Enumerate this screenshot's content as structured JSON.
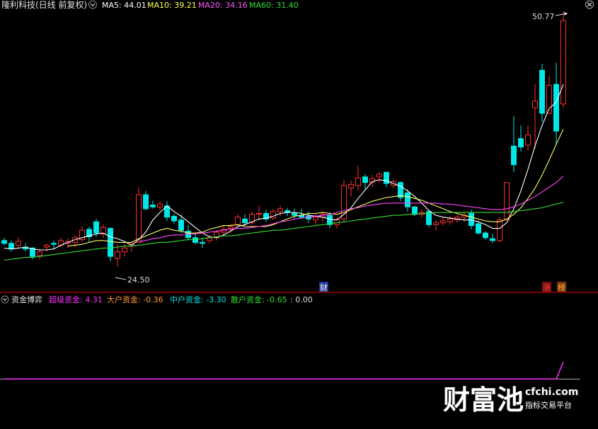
{
  "colors": {
    "background": "#000000",
    "grid": "#8b0000",
    "up": "#ff3030",
    "down": "#00e8e8",
    "ma5": "#ffffff",
    "ma10": "#ffff66",
    "ma20": "#ff44ff",
    "ma60": "#33dd33",
    "super": "#ff33ff",
    "big": "#ff9933",
    "mid": "#00e5e5",
    "retail": "#33dd33",
    "zero": "#dddddd",
    "header": "#e0e0e0"
  },
  "header": {
    "title": "隆利科技(日线 前复权)",
    "indicators": [
      {
        "label": "MA5: 44.01",
        "color": "#ffffff"
      },
      {
        "label": "MA10: 39.21",
        "color": "#ffff55"
      },
      {
        "label": "MA20: 34.16",
        "color": "#ff55ff"
      },
      {
        "label": "MA60: 31.40",
        "color": "#33dd33"
      }
    ]
  },
  "subchart_header": {
    "title": "资金博弈",
    "items": [
      {
        "label": "超级资金: 4.31",
        "color": "#ff33ff"
      },
      {
        "label": "大户资金: -0.36",
        "color": "#ff9933"
      },
      {
        "label": "中户资金: -3.30",
        "color": "#00e5e5"
      },
      {
        "label": "散户资金: -0.65",
        "color": "#33dd33"
      },
      {
        "label": ": 0.00",
        "color": "#dddddd"
      }
    ]
  },
  "annotations": {
    "high": "50.77",
    "low": "24.50",
    "marker_cai": "财",
    "marker_zhang": "涨",
    "marker_bang": "榜"
  },
  "watermark": {
    "brand": "财富池",
    "site": "cfchi.com",
    "slogan": "指标交易平台"
  },
  "chart_data": [
    {
      "type": "candlestick",
      "title": "隆利科技(日线 前复权)",
      "ylim": [
        23.5,
        51.8
      ],
      "candles": [
        [
          27.3,
          27.6,
          26.8,
          27.0
        ],
        [
          27.0,
          27.3,
          26.1,
          26.4
        ],
        [
          26.8,
          27.6,
          26.4,
          27.2
        ],
        [
          26.6,
          27.0,
          26.1,
          26.4
        ],
        [
          26.5,
          26.6,
          25.3,
          25.6
        ],
        [
          25.7,
          26.4,
          25.3,
          26.1
        ],
        [
          26.6,
          27.0,
          26.1,
          26.8
        ],
        [
          27.0,
          27.3,
          26.4,
          26.9
        ],
        [
          26.8,
          27.6,
          26.6,
          27.3
        ],
        [
          27.0,
          27.5,
          26.5,
          27.2
        ],
        [
          27.1,
          27.9,
          26.6,
          27.6
        ],
        [
          27.4,
          28.8,
          27.1,
          28.4
        ],
        [
          28.5,
          28.8,
          27.1,
          27.7
        ],
        [
          29.3,
          29.6,
          27.7,
          28.1
        ],
        [
          28.0,
          29.0,
          27.6,
          28.7
        ],
        [
          28.6,
          28.7,
          25.1,
          25.6
        ],
        [
          25.4,
          26.9,
          24.5,
          26.1
        ],
        [
          26.1,
          26.9,
          25.6,
          26.5
        ],
        [
          26.7,
          27.2,
          26.1,
          26.9
        ],
        [
          27.1,
          33.0,
          27.0,
          32.2
        ],
        [
          32.2,
          32.6,
          30.5,
          30.7
        ],
        [
          31.1,
          31.6,
          30.7,
          30.9
        ],
        [
          30.9,
          31.5,
          30.5,
          31.2
        ],
        [
          31.0,
          31.5,
          29.4,
          29.8
        ],
        [
          29.9,
          30.1,
          29.1,
          29.4
        ],
        [
          29.5,
          30.1,
          28.1,
          28.4
        ],
        [
          28.3,
          29.0,
          27.3,
          27.6
        ],
        [
          27.6,
          28.1,
          26.9,
          27.1
        ],
        [
          27.1,
          27.6,
          26.5,
          27.0
        ],
        [
          27.3,
          27.9,
          27.0,
          27.6
        ],
        [
          27.6,
          28.4,
          27.3,
          28.2
        ],
        [
          28.2,
          28.9,
          27.9,
          28.5
        ],
        [
          28.6,
          29.1,
          28.3,
          28.8
        ],
        [
          29.0,
          30.1,
          28.8,
          29.8
        ],
        [
          29.6,
          30.1,
          28.9,
          29.2
        ],
        [
          29.2,
          30.4,
          29.0,
          30.1
        ],
        [
          30.1,
          31.0,
          29.5,
          30.2
        ],
        [
          30.2,
          30.6,
          29.3,
          29.6
        ],
        [
          29.7,
          30.7,
          29.5,
          30.4
        ],
        [
          30.4,
          31.0,
          29.9,
          30.7
        ],
        [
          30.5,
          30.8,
          29.9,
          30.3
        ],
        [
          30.2,
          30.7,
          29.6,
          30.0
        ],
        [
          30.0,
          30.7,
          29.6,
          29.8
        ],
        [
          29.9,
          30.4,
          29.2,
          29.6
        ],
        [
          29.5,
          30.1,
          29.0,
          29.8
        ],
        [
          29.8,
          30.4,
          29.3,
          30.1
        ],
        [
          30.0,
          30.3,
          28.6,
          29.0
        ],
        [
          29.0,
          29.8,
          28.6,
          29.5
        ],
        [
          29.6,
          33.8,
          29.2,
          33.2
        ],
        [
          32.9,
          33.7,
          32.0,
          33.3
        ],
        [
          33.2,
          35.3,
          32.6,
          34.0
        ],
        [
          34.1,
          34.4,
          32.8,
          33.5
        ],
        [
          33.5,
          34.3,
          33.0,
          33.9
        ],
        [
          34.1,
          34.6,
          33.5,
          34.4
        ],
        [
          34.6,
          34.6,
          33.0,
          33.4
        ],
        [
          33.2,
          33.9,
          32.9,
          33.6
        ],
        [
          33.5,
          33.6,
          31.5,
          31.9
        ],
        [
          32.4,
          32.8,
          30.4,
          30.9
        ],
        [
          30.9,
          31.0,
          29.9,
          30.1
        ],
        [
          30.1,
          30.6,
          29.8,
          30.3
        ],
        [
          30.4,
          30.6,
          28.7,
          29.0
        ],
        [
          29.0,
          29.5,
          28.4,
          29.2
        ],
        [
          29.2,
          29.8,
          28.9,
          29.4
        ],
        [
          29.3,
          29.9,
          29.0,
          29.6
        ],
        [
          29.5,
          30.1,
          29.2,
          29.8
        ],
        [
          29.8,
          30.4,
          29.3,
          30.0
        ],
        [
          30.2,
          30.6,
          28.5,
          28.9
        ],
        [
          29.1,
          29.4,
          27.9,
          28.1
        ],
        [
          28.1,
          28.3,
          27.4,
          27.6
        ],
        [
          27.5,
          28.0,
          27.0,
          27.3
        ],
        [
          27.3,
          29.8,
          27.1,
          29.5
        ],
        [
          29.5,
          33.5,
          29.5,
          33.5
        ],
        [
          37.4,
          40.6,
          34.6,
          35.4
        ],
        [
          38.2,
          39.6,
          36.8,
          37.3
        ],
        [
          37.5,
          39.6,
          36.9,
          38.6
        ],
        [
          41.5,
          44.0,
          37.1,
          42.2
        ],
        [
          45.5,
          46.2,
          40.0,
          40.9
        ],
        [
          40.9,
          44.9,
          40.8,
          43.9
        ],
        [
          44.0,
          46.3,
          37.5,
          39.0
        ],
        [
          41.9,
          51.8,
          41.5,
          50.8
        ]
      ],
      "ma": {
        "ma5": [
          26.5,
          26.4,
          26.5,
          26.6,
          26.4,
          26.3,
          26.3,
          26.4,
          26.8,
          27.1,
          27.4,
          27.6,
          27.8,
          28.0,
          28.1,
          27.7,
          27.5,
          27.2,
          26.8,
          27.4,
          28.2,
          29.5,
          30.3,
          31.0,
          30.4,
          29.9,
          29.3,
          28.7,
          28.1,
          27.7,
          27.6,
          27.9,
          28.3,
          28.8,
          29.0,
          29.3,
          29.6,
          29.7,
          29.9,
          30.2,
          30.3,
          30.3,
          30.2,
          30.0,
          29.9,
          29.8,
          29.6,
          29.5,
          30.1,
          30.8,
          31.8,
          32.7,
          33.6,
          33.8,
          33.7,
          33.4,
          33.1,
          32.6,
          32.0,
          31.3,
          30.5,
          30.0,
          29.8,
          29.7,
          29.6,
          29.5,
          29.5,
          29.3,
          29.0,
          28.6,
          28.6,
          29.2,
          30.7,
          32.6,
          34.9,
          37.4,
          39.6,
          41.4,
          42.1,
          44.0
        ],
        "ma10": [
          null,
          null,
          null,
          null,
          null,
          null,
          null,
          null,
          null,
          26.7,
          26.8,
          26.9,
          27.1,
          27.3,
          27.3,
          27.2,
          27.1,
          27.1,
          27.1,
          27.5,
          27.8,
          28.1,
          28.4,
          28.6,
          28.4,
          28.3,
          28.1,
          28.1,
          28.2,
          28.5,
          28.7,
          28.9,
          28.9,
          29.0,
          28.8,
          28.8,
          28.8,
          28.8,
          29.0,
          29.3,
          29.6,
          29.9,
          30.0,
          30.2,
          30.2,
          30.3,
          30.2,
          30.1,
          30.3,
          30.6,
          30.9,
          31.2,
          31.5,
          31.7,
          31.9,
          32.0,
          32.1,
          32.0,
          31.8,
          31.6,
          31.3,
          31.0,
          30.7,
          30.4,
          30.2,
          30.0,
          29.8,
          29.6,
          29.4,
          29.3,
          29.3,
          29.6,
          30.1,
          30.8,
          31.8,
          32.9,
          34.3,
          35.9,
          37.6,
          39.2
        ],
        "ma20": [
          null,
          null,
          null,
          null,
          null,
          null,
          null,
          null,
          null,
          null,
          null,
          null,
          null,
          null,
          null,
          null,
          null,
          null,
          null,
          27.2,
          27.3,
          27.5,
          27.6,
          27.8,
          27.9,
          27.9,
          28.0,
          28.0,
          28.1,
          28.2,
          28.3,
          28.4,
          28.5,
          28.6,
          28.6,
          28.7,
          28.8,
          28.9,
          29.1,
          29.3,
          29.4,
          29.6,
          29.7,
          29.8,
          29.9,
          30.0,
          30.1,
          30.3,
          30.5,
          30.7,
          30.8,
          31.0,
          31.1,
          31.2,
          31.3,
          31.3,
          31.3,
          31.3,
          31.3,
          31.3,
          31.3,
          31.3,
          31.2,
          31.2,
          31.1,
          31.0,
          30.9,
          30.8,
          30.7,
          30.6,
          30.6,
          30.7,
          30.9,
          31.2,
          31.6,
          32.0,
          32.5,
          33.0,
          33.5,
          34.2
        ],
        "ma60": [
          25.2,
          25.3,
          25.4,
          25.5,
          25.5,
          25.6,
          25.7,
          25.8,
          25.9,
          26.0,
          26.1,
          26.2,
          26.3,
          26.4,
          26.5,
          26.5,
          26.6,
          26.7,
          26.7,
          26.8,
          26.9,
          27.0,
          27.1,
          27.1,
          27.2,
          27.3,
          27.4,
          27.4,
          27.5,
          27.6,
          27.7,
          27.8,
          27.8,
          27.9,
          28.0,
          28.1,
          28.2,
          28.3,
          28.4,
          28.4,
          28.5,
          28.6,
          28.7,
          28.8,
          28.9,
          29.0,
          29.1,
          29.2,
          29.3,
          29.4,
          29.5,
          29.6,
          29.7,
          29.8,
          29.9,
          30.0,
          30.0,
          30.1,
          30.1,
          30.2,
          30.2,
          30.3,
          30.3,
          30.3,
          30.3,
          30.3,
          30.3,
          30.3,
          30.3,
          30.3,
          30.3,
          30.3,
          30.4,
          30.5,
          30.6,
          30.7,
          30.8,
          31.0,
          31.2,
          31.4
        ]
      },
      "high_label": "50.77",
      "low_label": "24.50"
    },
    {
      "type": "line",
      "title": "资金博弈",
      "ylim": [
        -12,
        18
      ],
      "series": [
        {
          "name": "超级资金",
          "color": "#ff33ff",
          "values": [
            0.0,
            0.0,
            0.0,
            0.0,
            0.0,
            0.0,
            0.0,
            0.0,
            0.0,
            0.0,
            0.0,
            0.0,
            0.0,
            0.0,
            0.0,
            0.0,
            0.0,
            0.0,
            0.0,
            0.0,
            0.0,
            0.0,
            0.0,
            0.0,
            0.0,
            0.0,
            0.0,
            0.0,
            0.0,
            0.0,
            0.0,
            0.0,
            0.0,
            0.0,
            0.0,
            0.0,
            0.0,
            0.0,
            0.0,
            0.0,
            0.0,
            0.0,
            0.0,
            0.0,
            0.0,
            0.0,
            0.0,
            0.0,
            0.0,
            0.0,
            0.0,
            0.0,
            0.0,
            0.0,
            0.0,
            0.0,
            0.0,
            0.0,
            0.0,
            0.0,
            0.0,
            0.0,
            0.0,
            0.0,
            0.0,
            0.0,
            0.0,
            0.0,
            0.0,
            0.0,
            0.0,
            0.0,
            0.0,
            0.0,
            0.0,
            0.0,
            0.0,
            0.0,
            0.0,
            4.31
          ]
        }
      ]
    }
  ]
}
